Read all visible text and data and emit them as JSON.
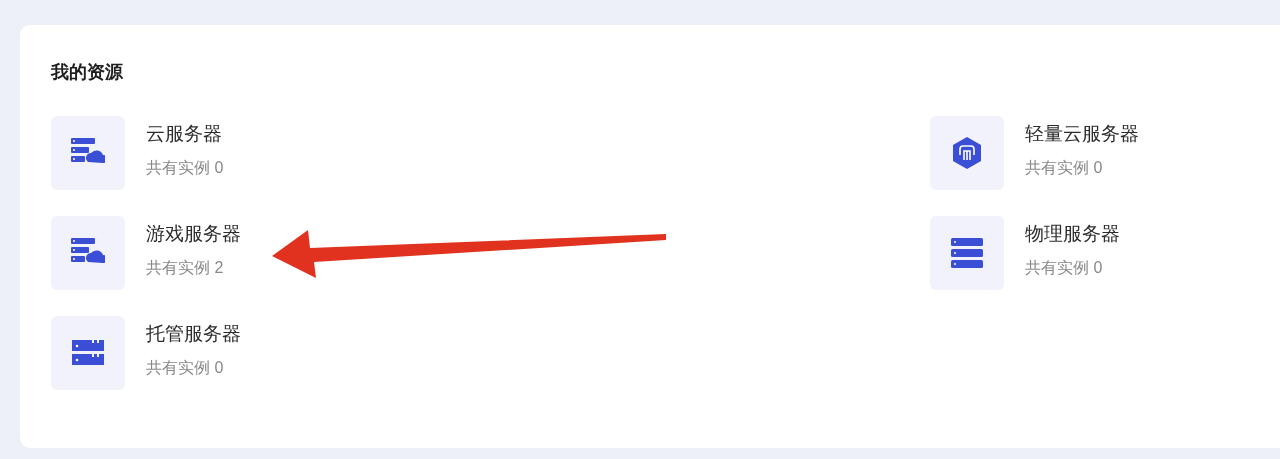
{
  "section": {
    "title": "我的资源"
  },
  "resources": [
    {
      "kind": "server-cloud",
      "name": "云服务器",
      "count": "共有实例 0"
    },
    {
      "kind": "hexagon",
      "name": "轻量云服务器",
      "count": "共有实例 0"
    },
    {
      "kind": "server-cloud",
      "name": "游戏服务器",
      "count": "共有实例 2"
    },
    {
      "kind": "server-stack",
      "name": "物理服务器",
      "count": "共有实例 0"
    },
    {
      "kind": "rack",
      "name": "托管服务器",
      "count": "共有实例 0"
    }
  ]
}
